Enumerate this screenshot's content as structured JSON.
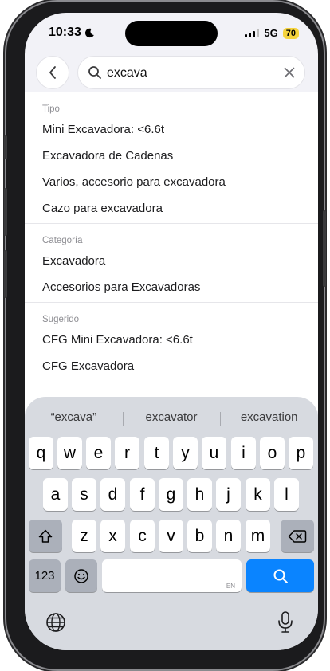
{
  "status_bar": {
    "time": "10:33",
    "network": "5G",
    "battery": "70"
  },
  "search": {
    "value": "excava",
    "placeholder": ""
  },
  "sections": [
    {
      "title": "Tipo",
      "items": [
        "Mini Excavadora: <6.6t",
        "Excavadora de Cadenas",
        "Varios, accesorio para excavadora",
        "Cazo para excavadora"
      ]
    },
    {
      "title": "Categoría",
      "items": [
        "Excavadora",
        "Accesorios para Excavadoras"
      ]
    },
    {
      "title": "Sugerido",
      "items": [
        "CFG Mini Excavadora: <6.6t",
        "CFG Excavadora"
      ]
    }
  ],
  "keyboard": {
    "suggestions": [
      "“excava”",
      "excavator",
      "excavation"
    ],
    "row1": [
      "q",
      "w",
      "e",
      "r",
      "t",
      "y",
      "u",
      "i",
      "o",
      "p"
    ],
    "row2": [
      "a",
      "s",
      "d",
      "f",
      "g",
      "h",
      "j",
      "k",
      "l"
    ],
    "row3": [
      "z",
      "x",
      "c",
      "v",
      "b",
      "n",
      "m"
    ],
    "numbers_label": "123",
    "space_hint": "EN"
  },
  "colors": {
    "search_key": "#0a84ff",
    "battery": "#f5d33d"
  },
  "icons": {
    "back": "chevron-left-icon",
    "search": "magnifier-icon",
    "clear": "close-icon",
    "shift": "shift-icon",
    "delete": "backspace-icon",
    "emoji": "emoji-icon",
    "globe": "globe-icon",
    "mic": "microphone-icon",
    "moon": "moon-icon"
  }
}
